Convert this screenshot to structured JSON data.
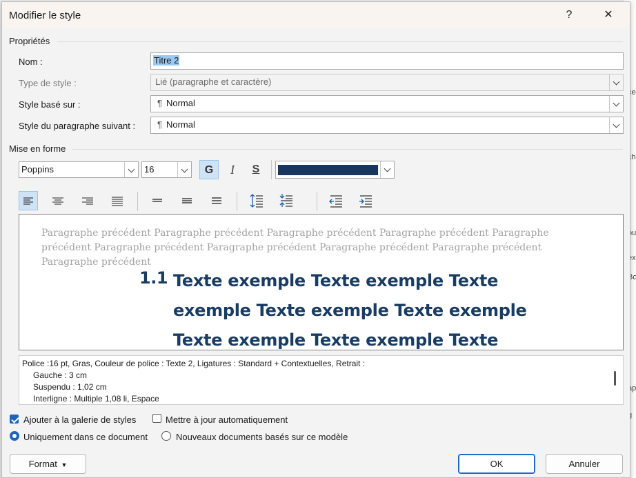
{
  "dialog": {
    "title": "Modifier le style",
    "help_label": "?",
    "close_label": "✕"
  },
  "properties": {
    "section_label": "Propriétés",
    "name_label": "Nom :",
    "name_value": "Titre 2",
    "type_label": "Type de style :",
    "type_value": "Lié (paragraphe et caractère)",
    "based_label": "Style basé sur :",
    "based_value": "Normal",
    "next_label": "Style du paragraphe suivant :",
    "next_value": "Normal",
    "pilcrow": "¶"
  },
  "formatting": {
    "section_label": "Mise en forme",
    "font": "Poppins",
    "size": "16",
    "bold_label": "G",
    "italic_label": "I",
    "underline_label": "S",
    "color": "#17375e"
  },
  "preview": {
    "previous_paragraph": "Paragraphe précédent Paragraphe précédent Paragraphe précédent Paragraphe précédent Paragraphe précédent Paragraphe précédent Paragraphe précédent Paragraphe précédent Paragraphe précédent Paragraphe précédent",
    "heading_number": "1.1",
    "heading_text": "Texte exemple Texte exemple Texte exemple Texte exemple Texte exemple Texte exemple Texte exemple Texte exemple Texte"
  },
  "description": {
    "line1": "Police :16 pt, Gras, Couleur de police : Texte 2, Ligatures : Standard + Contextuelles, Retrait :",
    "line2": "Gauche :  3 cm",
    "line3": "Suspendu : 1,02 cm",
    "line4": "Interligne : Multiple 1,08 li, Espace"
  },
  "options": {
    "add_gallery": "Ajouter à la galerie de styles",
    "auto_update": "Mettre à jour automatiquement",
    "only_doc": "Uniquement dans ce document",
    "new_docs": "Nouveaux documents basés sur ce modèle",
    "add_gallery_checked": true,
    "auto_update_checked": false,
    "scope": "only_doc"
  },
  "buttons": {
    "format": "Format",
    "ok": "OK",
    "cancel": "Annuler"
  },
  "background": {
    "fragments": [
      "ce",
      "ch",
      "ou",
      "ex",
      "Bo",
      "ap",
      "g"
    ]
  }
}
